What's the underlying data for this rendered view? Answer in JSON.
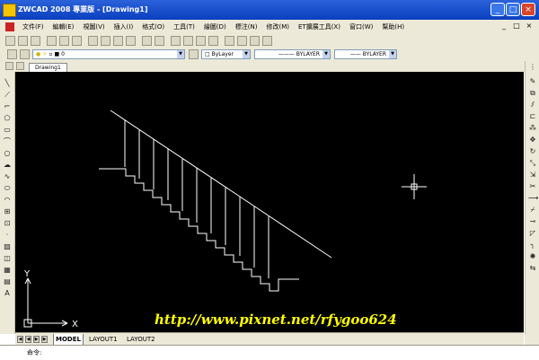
{
  "window": {
    "title": "ZWCAD 2008 專業版 - [Drawing1]",
    "controls": [
      "_",
      "□",
      "×"
    ]
  },
  "menu": {
    "items": [
      "文件(F)",
      "編輯(E)",
      "視圖(V)",
      "插入(I)",
      "格式(O)",
      "工具(T)",
      "繪圖(D)",
      "標注(N)",
      "修改(M)",
      "ET擴展工具(X)",
      "窗口(W)",
      "幫助(H)"
    ],
    "doc_controls": [
      "_",
      "□",
      "×"
    ]
  },
  "properties": {
    "layer_value": "0",
    "color_value": "ByLayer",
    "linetype_value": "BYLAYER",
    "lineweight_value": "BYLAYER"
  },
  "document_tab": "Drawing1",
  "layout_tabs": [
    "MODEL",
    "LAYOUT1",
    "LAYOUT2"
  ],
  "ucs": {
    "x_label": "X",
    "y_label": "Y"
  },
  "watermark": "http://www.pixnet.net/rfygoo624",
  "command_prompt": "命令:"
}
